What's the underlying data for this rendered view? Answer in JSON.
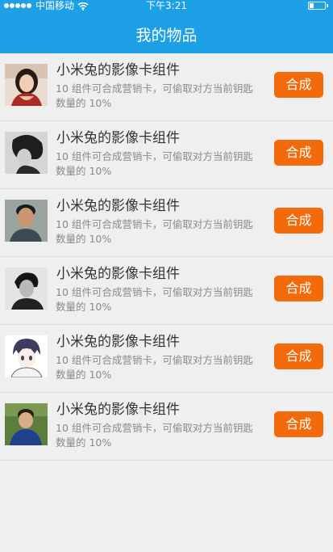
{
  "status_bar": {
    "carrier": "中国移动",
    "time": "下午3:21"
  },
  "nav": {
    "title": "我的物品"
  },
  "items": [
    {
      "title": "小米兔的影像卡组件",
      "desc": "10 组件可合成营销卡，可偷取对方当前钥匙数量的 10%",
      "button": "合成",
      "avatar_icon": "woman-photo-avatar"
    },
    {
      "title": "小米兔的影像卡组件",
      "desc": "10 组件可合成营销卡，可偷取对方当前钥匙数量的 10%",
      "button": "合成",
      "avatar_icon": "bw-profile-photo-avatar"
    },
    {
      "title": "小米兔的影像卡组件",
      "desc": "10 组件可合成营销卡，可偷取对方当前钥匙数量的 10%",
      "button": "合成",
      "avatar_icon": "man-photo-avatar"
    },
    {
      "title": "小米兔的影像卡组件",
      "desc": "10 组件可合成营销卡，可偷取对方当前钥匙数量的 10%",
      "button": "合成",
      "avatar_icon": "bw-man-photo-avatar"
    },
    {
      "title": "小米兔的影像卡组件",
      "desc": "10 组件可合成营销卡，可偷取对方当前钥匙数量的 10%",
      "button": "合成",
      "avatar_icon": "anime-boy-avatar"
    },
    {
      "title": "小米兔的影像卡组件",
      "desc": "10 组件可合成营销卡，可偷取对方当前钥匙数量的 10%",
      "button": "合成",
      "avatar_icon": "boy-photo-avatar"
    }
  ],
  "colors": {
    "header": "#1ea0e6",
    "button": "#f36a0b",
    "background": "#efefef"
  }
}
